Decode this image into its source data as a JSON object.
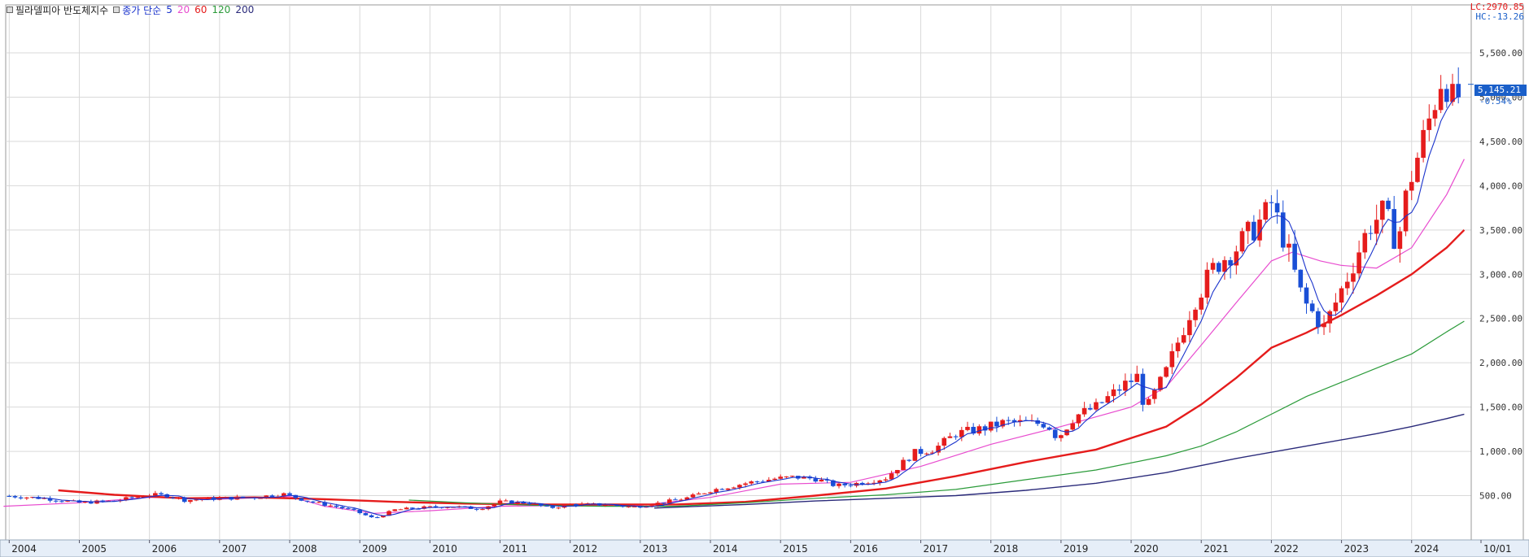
{
  "legend": {
    "title": "필라델피아 반도체지수",
    "close_label": "종가 단순",
    "ma": [
      {
        "label": "5",
        "color": "#1a33cc"
      },
      {
        "label": "20",
        "color": "#e84ccf"
      },
      {
        "label": "60",
        "color": "#e51c1c"
      },
      {
        "label": "120",
        "color": "#2b9b3a"
      },
      {
        "label": "200",
        "color": "#2a2a7a"
      }
    ]
  },
  "topright": {
    "lc": "LC:2970.85",
    "hc": "HC:-13.26"
  },
  "last_price": {
    "value": "5,145.21",
    "change": "-0.54%"
  },
  "colors": {
    "up": "#e51c1c",
    "down": "#1a4fd6",
    "grid": "#d9d9d9",
    "axis_bg": "#e6eef8"
  },
  "chart_data": {
    "type": "candlestick",
    "title": "필라델피아 반도체지수",
    "x_ticks": [
      "2004",
      "2005",
      "2006",
      "2007",
      "2008",
      "2009",
      "2010",
      "2011",
      "2012",
      "2013",
      "2014",
      "2015",
      "2016",
      "2017",
      "2018",
      "2019",
      "2020",
      "2021",
      "2022",
      "2023",
      "2024",
      "10/01"
    ],
    "y_ticks": [
      "500.00",
      "1,000.00",
      "1,500.00",
      "2,000.00",
      "2,500.00",
      "3,000.00",
      "3,500.00",
      "4,000.00",
      "4,500.00",
      "5,000.00",
      "5,500.00"
    ],
    "ylim": [
      0,
      5950
    ],
    "xlim": [
      2003.95,
      2024.85
    ],
    "close_series": {
      "x": [
        2003.92,
        2004.5,
        2005.0,
        2005.5,
        2006.0,
        2006.3,
        2006.5,
        2007.0,
        2007.5,
        2007.9,
        2008.3,
        2008.7,
        2008.95,
        2009.2,
        2009.5,
        2010.0,
        2010.3,
        2010.7,
        2011.0,
        2011.4,
        2011.7,
        2012.0,
        2012.5,
        2012.9,
        2013.3,
        2013.7,
        2014.0,
        2014.5,
        2014.9,
        2015.2,
        2015.5,
        2015.8,
        2016.1,
        2016.5,
        2016.9,
        2017.2,
        2017.5,
        2017.9,
        2018.2,
        2018.5,
        2018.8,
        2018.95,
        2019.2,
        2019.5,
        2019.9,
        2020.1,
        2020.2,
        2020.5,
        2020.9,
        2021.2,
        2021.5,
        2021.9,
        2022.0,
        2022.2,
        2022.45,
        2022.75,
        2022.9,
        2023.1,
        2023.4,
        2023.6,
        2023.8,
        2023.95,
        2024.2,
        2024.45,
        2024.6,
        2024.75
      ],
      "values": [
        500,
        470,
        420,
        440,
        510,
        500,
        450,
        470,
        480,
        520,
        430,
        370,
        320,
        240,
        340,
        370,
        380,
        350,
        430,
        420,
        360,
        400,
        400,
        370,
        420,
        480,
        560,
        640,
        690,
        710,
        690,
        610,
        640,
        700,
        980,
        1030,
        1200,
        1260,
        1330,
        1320,
        1310,
        1150,
        1400,
        1500,
        1750,
        1850,
        1450,
        1900,
        2700,
        3100,
        3300,
        3650,
        3800,
        3350,
        2700,
        2400,
        2650,
        3000,
        3550,
        3700,
        3350,
        4000,
        4600,
        5300,
        4900,
        5145
      ]
    },
    "ma_series": [
      {
        "name": "20",
        "x": [
          2003.92,
          2005,
          2006,
          2007,
          2008,
          2008.5,
          2009.2,
          2010,
          2011,
          2012,
          2013,
          2014,
          2015,
          2016,
          2017,
          2018,
          2019,
          2020,
          2020.5,
          2021,
          2021.5,
          2022,
          2022.3,
          2022.7,
          2023,
          2023.5,
          2024,
          2024.5,
          2024.75
        ],
        "values": [
          380,
          420,
          480,
          460,
          490,
          380,
          300,
          330,
          380,
          390,
          390,
          480,
          630,
          650,
          830,
          1080,
          1280,
          1500,
          1730,
          2200,
          2680,
          3150,
          3250,
          3150,
          3100,
          3070,
          3300,
          3900,
          4300
        ]
      },
      {
        "name": "60",
        "x": [
          2004.7,
          2005.5,
          2006.5,
          2007.5,
          2008.5,
          2009.5,
          2010.5,
          2011.5,
          2012.5,
          2013.5,
          2014.5,
          2015.5,
          2016.5,
          2017.5,
          2018.5,
          2019.5,
          2020.5,
          2021.0,
          2021.5,
          2022.0,
          2022.5,
          2023.0,
          2023.5,
          2024.0,
          2024.5,
          2024.75
        ],
        "values": [
          560,
          510,
          470,
          480,
          460,
          430,
          410,
          400,
          400,
          400,
          430,
          500,
          580,
          720,
          880,
          1020,
          1280,
          1530,
          1830,
          2170,
          2340,
          2540,
          2760,
          3000,
          3300,
          3500
        ]
      },
      {
        "name": "120",
        "x": [
          2009.7,
          2010.5,
          2011.5,
          2012.5,
          2013.5,
          2014.5,
          2015.5,
          2016.5,
          2017.5,
          2018.5,
          2019.5,
          2020.5,
          2021.0,
          2021.5,
          2022.0,
          2022.5,
          2023.0,
          2023.5,
          2024.0,
          2024.5,
          2024.75
        ],
        "values": [
          450,
          420,
          390,
          380,
          380,
          420,
          470,
          510,
          570,
          680,
          790,
          950,
          1060,
          1220,
          1420,
          1620,
          1780,
          1940,
          2100,
          2350,
          2470
        ]
      },
      {
        "name": "200",
        "x": [
          2013.2,
          2014.5,
          2015.5,
          2016.5,
          2017.5,
          2018.5,
          2019.5,
          2020.5,
          2021.5,
          2022.5,
          2023.5,
          2024.0,
          2024.5,
          2024.75
        ],
        "values": [
          360,
          400,
          440,
          470,
          500,
          560,
          640,
          760,
          920,
          1060,
          1200,
          1280,
          1370,
          1420
        ]
      }
    ]
  }
}
